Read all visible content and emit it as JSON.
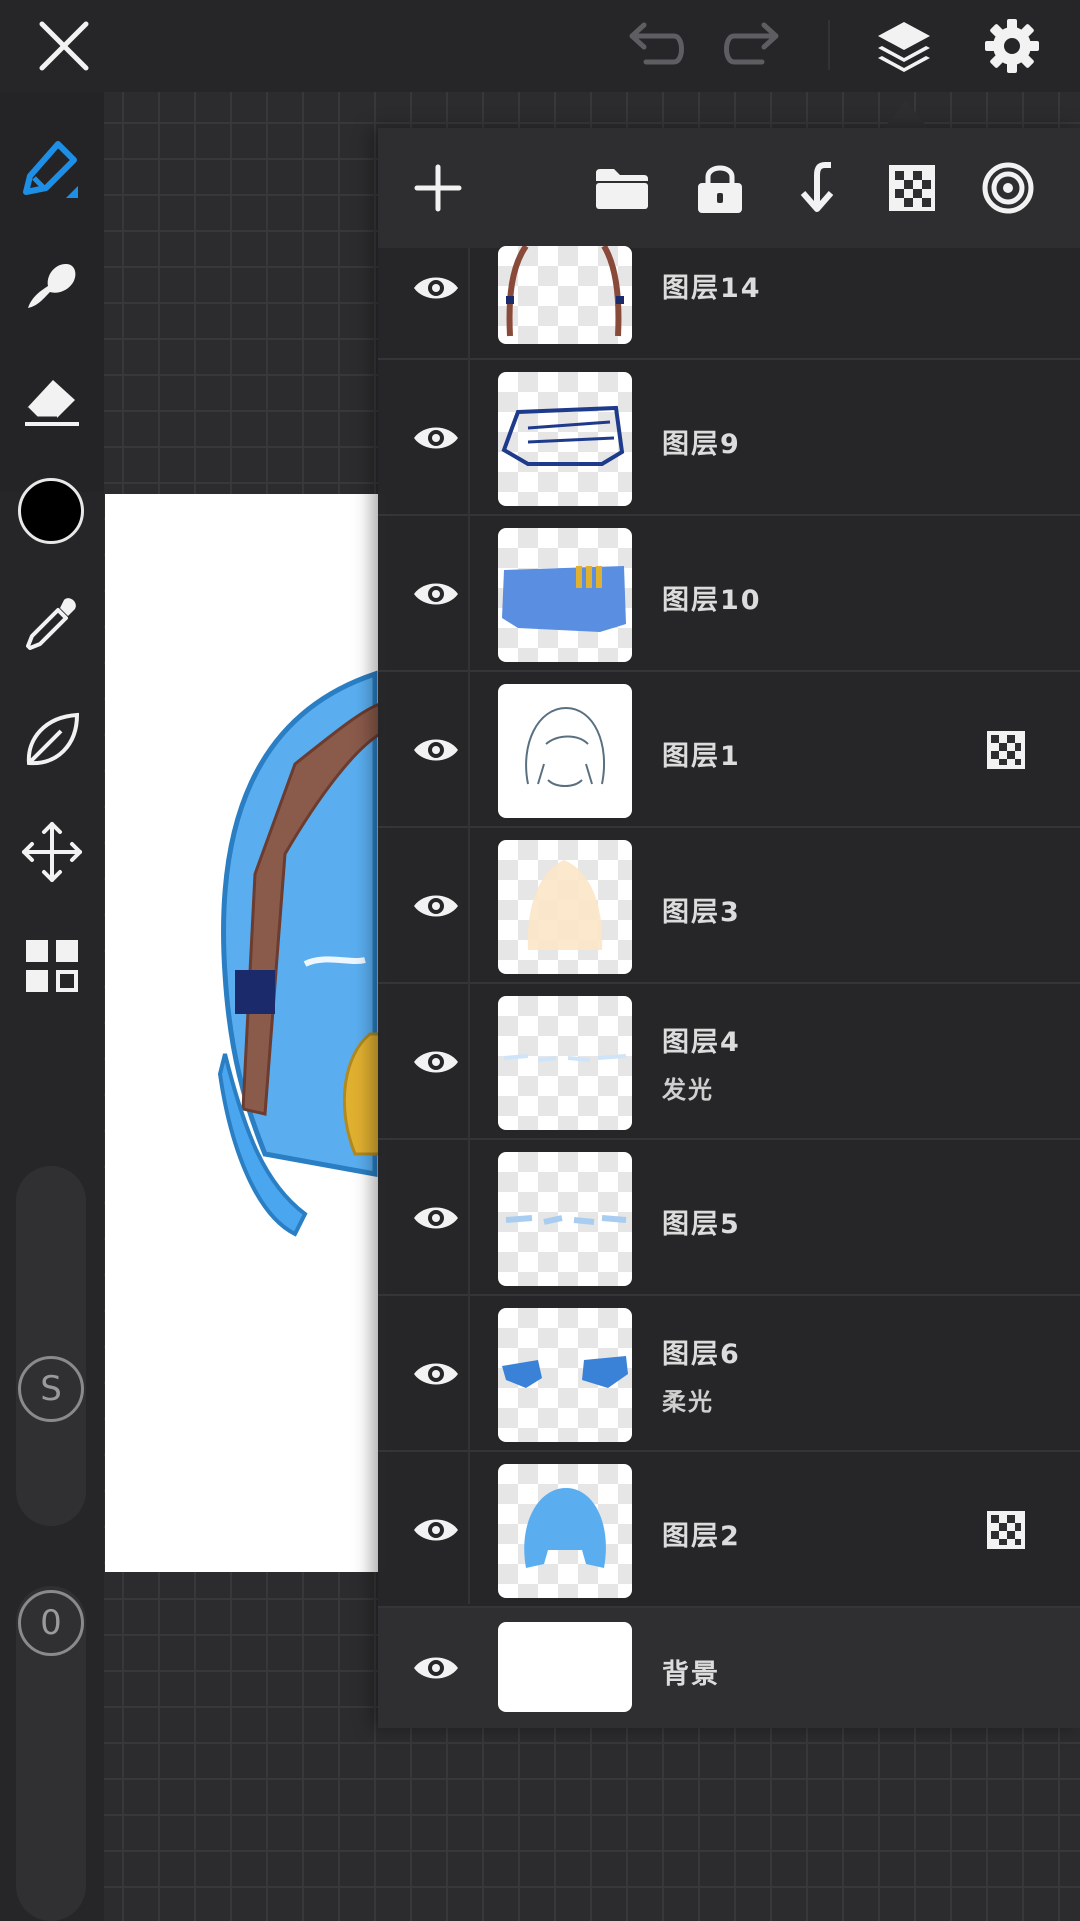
{
  "app": {
    "accent_color": "#1e8fe6",
    "current_color": "#000000"
  },
  "topbar": {
    "icons": [
      "close-icon",
      "undo-icon",
      "redo-icon",
      "layers-icon",
      "settings-icon"
    ]
  },
  "toolbar": {
    "tools": [
      "pen-icon",
      "smudge-icon",
      "eraser-icon",
      "color-swatch",
      "eyedropper-icon",
      "leaf-icon",
      "move-icon",
      "grid-icon"
    ],
    "size_knob_label": "S",
    "opacity_knob_label": "0"
  },
  "layers_panel": {
    "actions": [
      "add-layer-icon",
      "folder-icon",
      "lock-icon",
      "merge-down-icon",
      "checker-icon",
      "target-icon"
    ],
    "layers": [
      {
        "name": "图层14",
        "blend": "",
        "mask": false,
        "visible": true
      },
      {
        "name": "图层9",
        "blend": "",
        "mask": false,
        "visible": true
      },
      {
        "name": "图层10",
        "blend": "",
        "mask": false,
        "visible": true
      },
      {
        "name": "图层1",
        "blend": "",
        "mask": true,
        "visible": true
      },
      {
        "name": "图层3",
        "blend": "",
        "mask": false,
        "visible": true
      },
      {
        "name": "图层4",
        "blend": "发光",
        "mask": false,
        "visible": true
      },
      {
        "name": "图层5",
        "blend": "",
        "mask": false,
        "visible": true
      },
      {
        "name": "图层6",
        "blend": "柔光",
        "mask": false,
        "visible": true
      },
      {
        "name": "图层2",
        "blend": "",
        "mask": true,
        "visible": true
      },
      {
        "name": "背景",
        "blend": "",
        "mask": false,
        "visible": true
      }
    ]
  }
}
